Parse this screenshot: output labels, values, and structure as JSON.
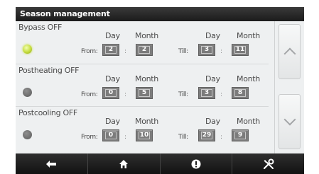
{
  "title": "Season management",
  "columns": {
    "day": "Day",
    "month": "Month"
  },
  "labels": {
    "from": "From:",
    "till": "Till:",
    "sep": ":"
  },
  "sections": [
    {
      "name": "Bypass OFF",
      "active": true,
      "from_day": "2",
      "from_month": "2",
      "till_day": "3",
      "till_month": "11"
    },
    {
      "name": "Postheating OFF",
      "active": false,
      "from_day": "0",
      "from_month": "5",
      "till_day": "3",
      "till_month": "8"
    },
    {
      "name": "Postcooling OFF",
      "active": false,
      "from_day": "0",
      "from_month": "10",
      "till_day": "29",
      "till_month": "9"
    }
  ],
  "scroll": {
    "up_icon": "chevron-up-icon",
    "down_icon": "chevron-down-icon"
  },
  "nav": [
    {
      "icon": "back-arrow-icon"
    },
    {
      "icon": "home-icon"
    },
    {
      "icon": "info-icon"
    },
    {
      "icon": "tools-icon"
    }
  ],
  "colors": {
    "led_on": "#c4db3c",
    "led_off": "#6a6a6a",
    "field": "#7c7c7c",
    "bar": "#1b1b1b"
  }
}
